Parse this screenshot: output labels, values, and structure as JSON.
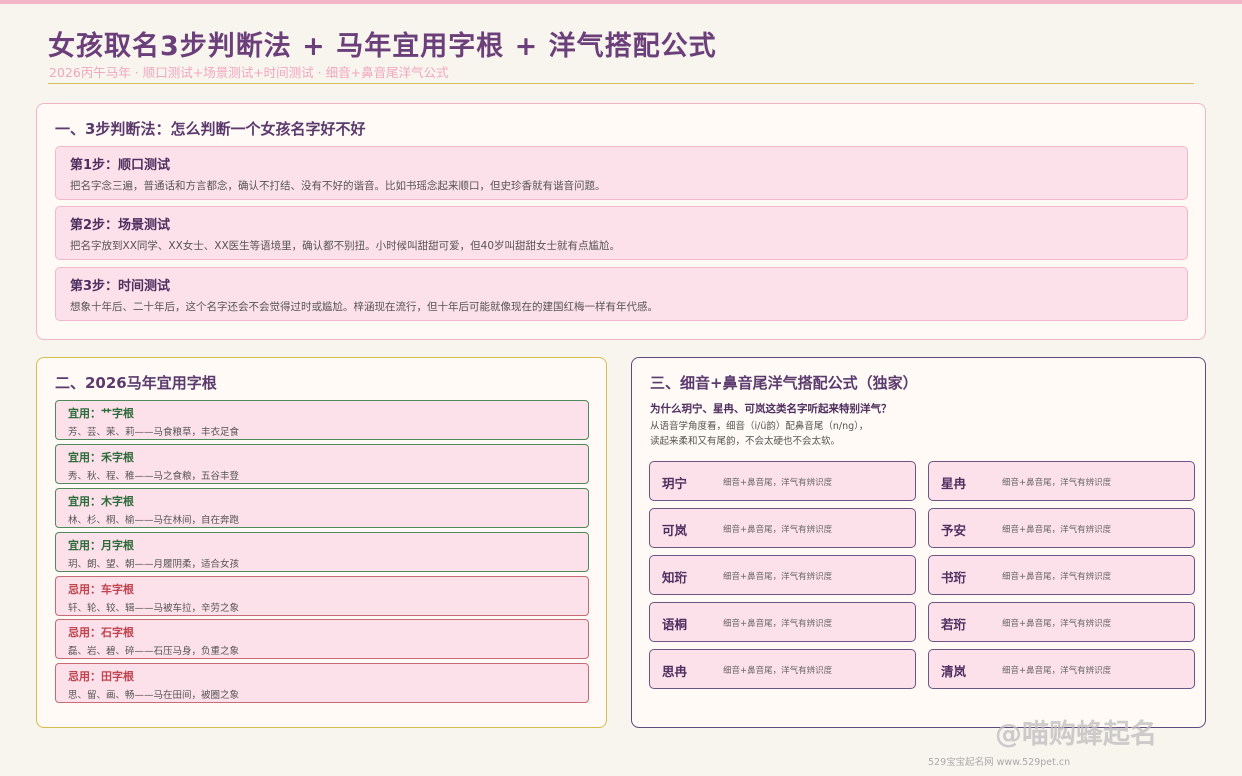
{
  "title": "女孩取名3步判断法 + 马年宜用字根 + 洋气搭配公式",
  "subtitle": "2026丙午马年 · 顺口测试+场景测试+时间测试 · 细音+鼻音尾洋气公式",
  "steps_section": {
    "title": "一、3步判断法：怎么判断一个女孩名字好不好",
    "steps": [
      {
        "title": "第1步：顺口测试",
        "desc": "把名字念三遍，普通话和方言都念，确认不打结、没有不好的谐音。比如书瑶念起来顺口，但史珍香就有谐音问题。"
      },
      {
        "title": "第2步：场景测试",
        "desc": "把名字放到XX同学、XX女士、XX医生等语境里，确认都不别扭。小时候叫甜甜可爱，但40岁叫甜甜女士就有点尴尬。"
      },
      {
        "title": "第3步：时间测试",
        "desc": "想象十年后、二十年后，这个名字还会不会觉得过时或尴尬。梓涵现在流行，但十年后可能就像现在的建国红梅一样有年代感。"
      }
    ]
  },
  "roots_section": {
    "title": "二、2026马年宜用字根",
    "roots": [
      {
        "type": "good",
        "title": "宜用：艹字根",
        "desc": "芳、芸、茉、莉——马食粮草，丰衣足食"
      },
      {
        "type": "good",
        "title": "宜用：禾字根",
        "desc": "秀、秋、程、稚——马之食粮，五谷丰登"
      },
      {
        "type": "good",
        "title": "宜用：木字根",
        "desc": "林、杉、桐、榆——马在林间，自在奔跑"
      },
      {
        "type": "good",
        "title": "宜用：月字根",
        "desc": "玥、朗、望、朝——月履阴柔，适合女孩"
      },
      {
        "type": "bad",
        "title": "忌用：车字根",
        "desc": "轩、轮、较、辑——马被车拉，辛劳之象"
      },
      {
        "type": "bad",
        "title": "忌用：石字根",
        "desc": "磊、岩、碧、碎——石压马身，负重之象"
      },
      {
        "type": "bad",
        "title": "忌用：田字根",
        "desc": "思、留、画、畅——马在田间，被圈之象"
      }
    ]
  },
  "formula_section": {
    "title": "三、细音+鼻音尾洋气搭配公式（独家）",
    "question": "为什么玥宁、星冉、可岚这类名字听起来特别洋气？",
    "explanation_1": "从语音学角度看，细音（i/ü韵）配鼻音尾（n/ng），",
    "explanation_2": "读起来柔和又有尾韵，不会太硬也不会太软。",
    "names": [
      {
        "name": "玥宁",
        "desc": "细音+鼻音尾，洋气有辨识度"
      },
      {
        "name": "星冉",
        "desc": "细音+鼻音尾，洋气有辨识度"
      },
      {
        "name": "可岚",
        "desc": "细音+鼻音尾，洋气有辨识度"
      },
      {
        "name": "予安",
        "desc": "细音+鼻音尾，洋气有辨识度"
      },
      {
        "name": "知珩",
        "desc": "细音+鼻音尾，洋气有辨识度"
      },
      {
        "name": "书珩",
        "desc": "细音+鼻音尾，洋气有辨识度"
      },
      {
        "name": "语桐",
        "desc": "细音+鼻音尾，洋气有辨识度"
      },
      {
        "name": "若珩",
        "desc": "细音+鼻音尾，洋气有辨识度"
      },
      {
        "name": "思冉",
        "desc": "细音+鼻音尾，洋气有辨识度"
      },
      {
        "name": "清岚",
        "desc": "细音+鼻音尾，洋气有辨识度"
      }
    ]
  },
  "watermark": "@喵购蜂起名",
  "footer": "529宝宝起名网  www.529pet.cn",
  "colors": {
    "accent_purple": "#6b3f7a",
    "pink_box": "#fde1ea",
    "good_green": "#2e6b3c",
    "bad_red": "#c0434f",
    "gold_border": "#d8bd4e"
  }
}
